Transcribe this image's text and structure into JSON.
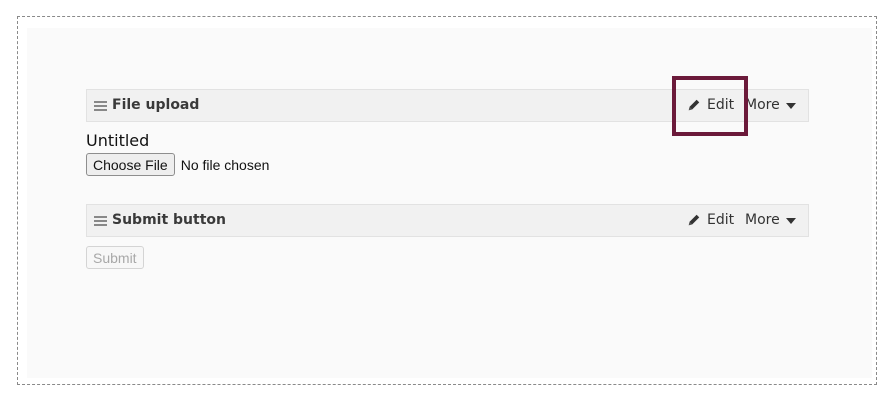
{
  "components": [
    {
      "id": "file-upload",
      "title": "File upload",
      "edit_label": "Edit",
      "more_label": "More"
    },
    {
      "id": "submit-button",
      "title": "Submit button",
      "edit_label": "Edit",
      "more_label": "More"
    }
  ],
  "file_field": {
    "label": "Untitled",
    "button_label": "Choose File",
    "status_text": "No file chosen"
  },
  "submit": {
    "label": "Submit",
    "disabled": true
  },
  "icons": {
    "grip": "drag-handle-icon",
    "edit": "pencil-icon",
    "more": "caret-down-icon"
  },
  "colors": {
    "highlight": "#6b1a3a",
    "header_bg": "#f1f1f1",
    "frame_border": "#8a8a8a"
  }
}
